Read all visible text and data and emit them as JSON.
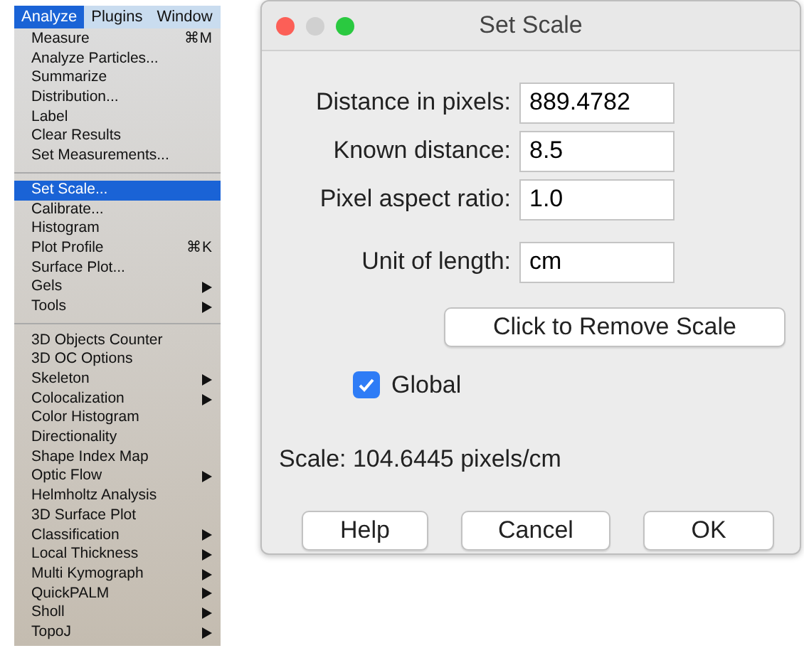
{
  "menu_bar": [
    {
      "label": "Analyze",
      "selected": true
    },
    {
      "label": "Plugins",
      "selected": false
    },
    {
      "label": "Window",
      "selected": false
    }
  ],
  "menu": {
    "groups": [
      {
        "items": [
          {
            "label": "Measure",
            "shortcut": "⌘M",
            "submenu": false,
            "selected": false
          },
          {
            "label": "Analyze Particles...",
            "submenu": false,
            "selected": false
          },
          {
            "label": "Summarize",
            "submenu": false,
            "selected": false
          },
          {
            "label": "Distribution...",
            "submenu": false,
            "selected": false
          },
          {
            "label": "Label",
            "submenu": false,
            "selected": false
          },
          {
            "label": "Clear Results",
            "submenu": false,
            "selected": false
          },
          {
            "label": "Set Measurements...",
            "submenu": false,
            "selected": false
          }
        ]
      },
      {
        "items": [
          {
            "label": "Set Scale...",
            "submenu": false,
            "selected": true
          },
          {
            "label": "Calibrate...",
            "submenu": false,
            "selected": false
          },
          {
            "label": "Histogram",
            "submenu": false,
            "selected": false
          },
          {
            "label": "Plot Profile",
            "shortcut": "⌘K",
            "submenu": false,
            "selected": false
          },
          {
            "label": "Surface Plot...",
            "submenu": false,
            "selected": false
          },
          {
            "label": "Gels",
            "submenu": true,
            "selected": false
          },
          {
            "label": "Tools",
            "submenu": true,
            "selected": false
          }
        ]
      },
      {
        "items": [
          {
            "label": "3D Objects Counter",
            "submenu": false,
            "selected": false
          },
          {
            "label": "3D OC Options",
            "submenu": false,
            "selected": false
          },
          {
            "label": "Skeleton",
            "submenu": true,
            "selected": false
          },
          {
            "label": "Colocalization",
            "submenu": true,
            "selected": false
          },
          {
            "label": "Color Histogram",
            "submenu": false,
            "selected": false
          },
          {
            "label": "Directionality",
            "submenu": false,
            "selected": false
          },
          {
            "label": "Shape Index Map",
            "submenu": false,
            "selected": false
          },
          {
            "label": "Optic Flow",
            "submenu": true,
            "selected": false
          },
          {
            "label": "Helmholtz Analysis",
            "submenu": false,
            "selected": false
          },
          {
            "label": "3D Surface Plot",
            "submenu": false,
            "selected": false
          },
          {
            "label": "Classification",
            "submenu": true,
            "selected": false
          },
          {
            "label": "Local Thickness",
            "submenu": true,
            "selected": false
          },
          {
            "label": "Multi Kymograph",
            "submenu": true,
            "selected": false
          },
          {
            "label": "QuickPALM",
            "submenu": true,
            "selected": false
          },
          {
            "label": "Sholl",
            "submenu": true,
            "selected": false
          },
          {
            "label": "TopoJ",
            "submenu": true,
            "selected": false
          }
        ]
      }
    ]
  },
  "dialog": {
    "title": "Set Scale",
    "fields": [
      {
        "label": "Distance in pixels:",
        "value": "889.4782"
      },
      {
        "label": "Known distance:",
        "value": "8.5"
      },
      {
        "label": "Pixel aspect ratio:",
        "value": "1.0"
      },
      {
        "label": "Unit of length:",
        "value": "cm"
      }
    ],
    "remove_button": "Click to Remove Scale",
    "checkbox": {
      "label": "Global",
      "checked": true
    },
    "scale_text": "Scale: 104.6445 pixels/cm",
    "buttons": [
      "Help",
      "Cancel",
      "OK"
    ]
  }
}
